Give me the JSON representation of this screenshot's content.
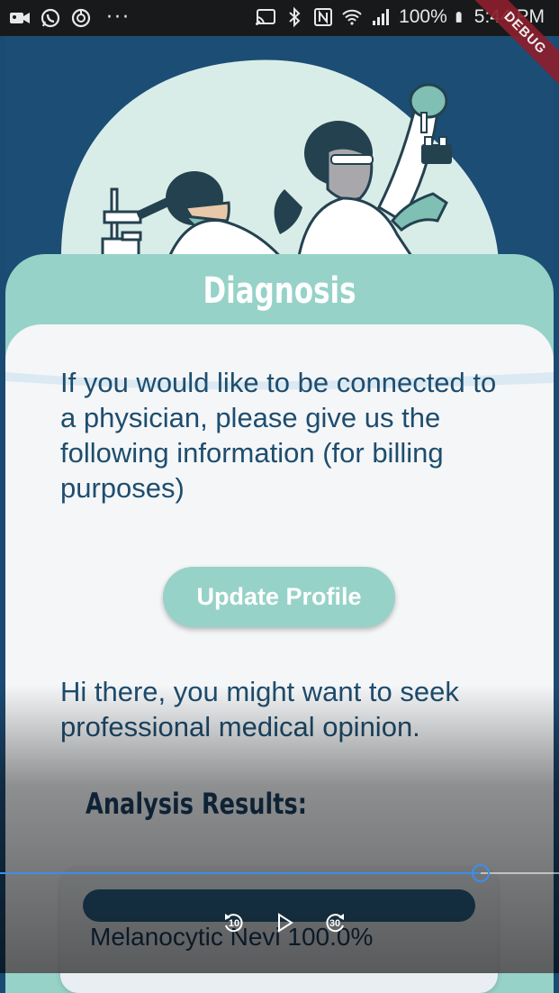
{
  "status_bar": {
    "battery": "100%",
    "time": "5:44 PM",
    "icons": [
      "video-camera-icon",
      "whatsapp-icon",
      "sync-icon",
      "more-dots-icon",
      "cast-icon",
      "bluetooth-icon",
      "nfc-icon",
      "wifi-icon",
      "signal-icon",
      "battery-icon"
    ]
  },
  "debug_banner": "DEBUG",
  "card": {
    "title": "Diagnosis"
  },
  "info_text": "If you would like to be connected to a physician, please give us the following information (for billing purposes)",
  "update_profile_button": "Update Profile",
  "advice_text": "Hi there, you might want to seek professional medical opinion.",
  "results": {
    "title": "Analysis Results:",
    "items": [
      {
        "label": "Melanocytic Nevi 100.0%",
        "value": 1.0
      }
    ]
  },
  "video_overlay": {
    "rewind_label": "10",
    "forward_label": "30",
    "progress": 0.86
  },
  "colors": {
    "header_bg": "#1b4a72",
    "accent": "#96d2c8",
    "panel_bg": "#f4f6f8",
    "text_dark": "#1e4d6e",
    "scrub": "#3d8ee8"
  }
}
